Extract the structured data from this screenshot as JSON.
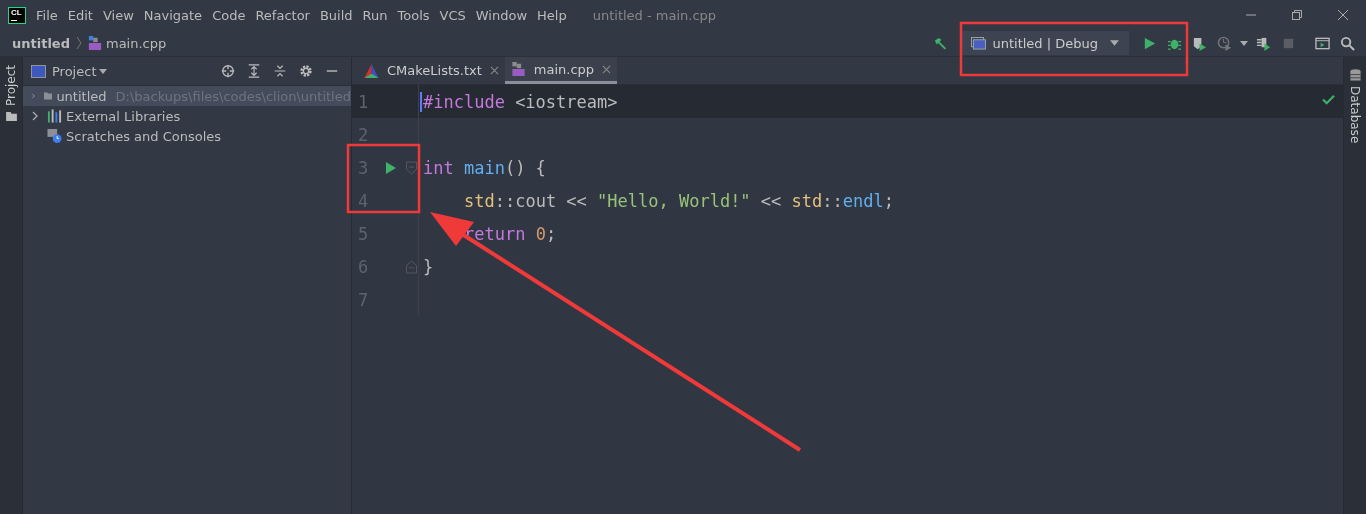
{
  "window": {
    "title": "untitled - main.cpp",
    "logo": "CL"
  },
  "menu": [
    "File",
    "Edit",
    "View",
    "Navigate",
    "Code",
    "Refactor",
    "Build",
    "Run",
    "Tools",
    "VCS",
    "Window",
    "Help"
  ],
  "breadcrumb": [
    "untitled",
    "main.cpp"
  ],
  "toolbar": {
    "run_configuration": "untitled | Debug"
  },
  "left_stripe": {
    "label": "Project"
  },
  "right_stripe": {
    "label": "Database"
  },
  "project_panel": {
    "title": "Project",
    "items": [
      {
        "label": "untitled",
        "hint": "D:\\backups\\files\\codes\\clion\\untitled",
        "kind": "folder",
        "expanded": false,
        "selected": true
      },
      {
        "label": "External Libraries",
        "kind": "libraries",
        "expanded": false,
        "selected": false
      },
      {
        "label": "Scratches and Consoles",
        "kind": "scratches",
        "selected": false
      }
    ]
  },
  "tabs": [
    {
      "label": "CMakeLists.txt",
      "kind": "cmake",
      "selected": false
    },
    {
      "label": "main.cpp",
      "kind": "cpp",
      "selected": true
    }
  ],
  "editor": {
    "lines": [
      {
        "number": "1",
        "current": true,
        "tokens": [
          {
            "text": "#include",
            "kind": "keyword"
          },
          {
            "text": " <iostream>",
            "kind": "plain"
          }
        ]
      },
      {
        "number": "2",
        "current": false
      },
      {
        "number": "3",
        "current": false,
        "run": true,
        "fold_start": true,
        "tokens": [
          {
            "text": "int ",
            "kind": "keyword"
          },
          {
            "text": "main",
            "kind": "function"
          },
          {
            "text": "() {",
            "kind": "plain"
          }
        ]
      },
      {
        "number": "4",
        "current": false,
        "indented": true,
        "tokens": [
          {
            "text": "std",
            "kind": "namespace"
          },
          {
            "text": "::cout << ",
            "kind": "plain"
          },
          {
            "text": "\"Hello, World!\"",
            "kind": "string"
          },
          {
            "text": " << ",
            "kind": "plain"
          },
          {
            "text": "std",
            "kind": "namespace"
          },
          {
            "text": "::",
            "kind": "plain"
          },
          {
            "text": "endl",
            "kind": "function"
          },
          {
            "text": ";",
            "kind": "plain"
          }
        ]
      },
      {
        "number": "5",
        "current": false,
        "indented": true,
        "tokens": [
          {
            "text": "return ",
            "kind": "keyword"
          },
          {
            "text": "0",
            "kind": "number"
          },
          {
            "text": ";",
            "kind": "plain"
          }
        ]
      },
      {
        "number": "6",
        "current": false,
        "fold_end": true,
        "tokens": [
          {
            "text": "}",
            "kind": "plain"
          }
        ]
      },
      {
        "number": "7",
        "current": false
      }
    ]
  },
  "annotations": [
    {
      "kind": "box"
    },
    {
      "kind": "box"
    },
    {
      "kind": "arrow"
    }
  ]
}
